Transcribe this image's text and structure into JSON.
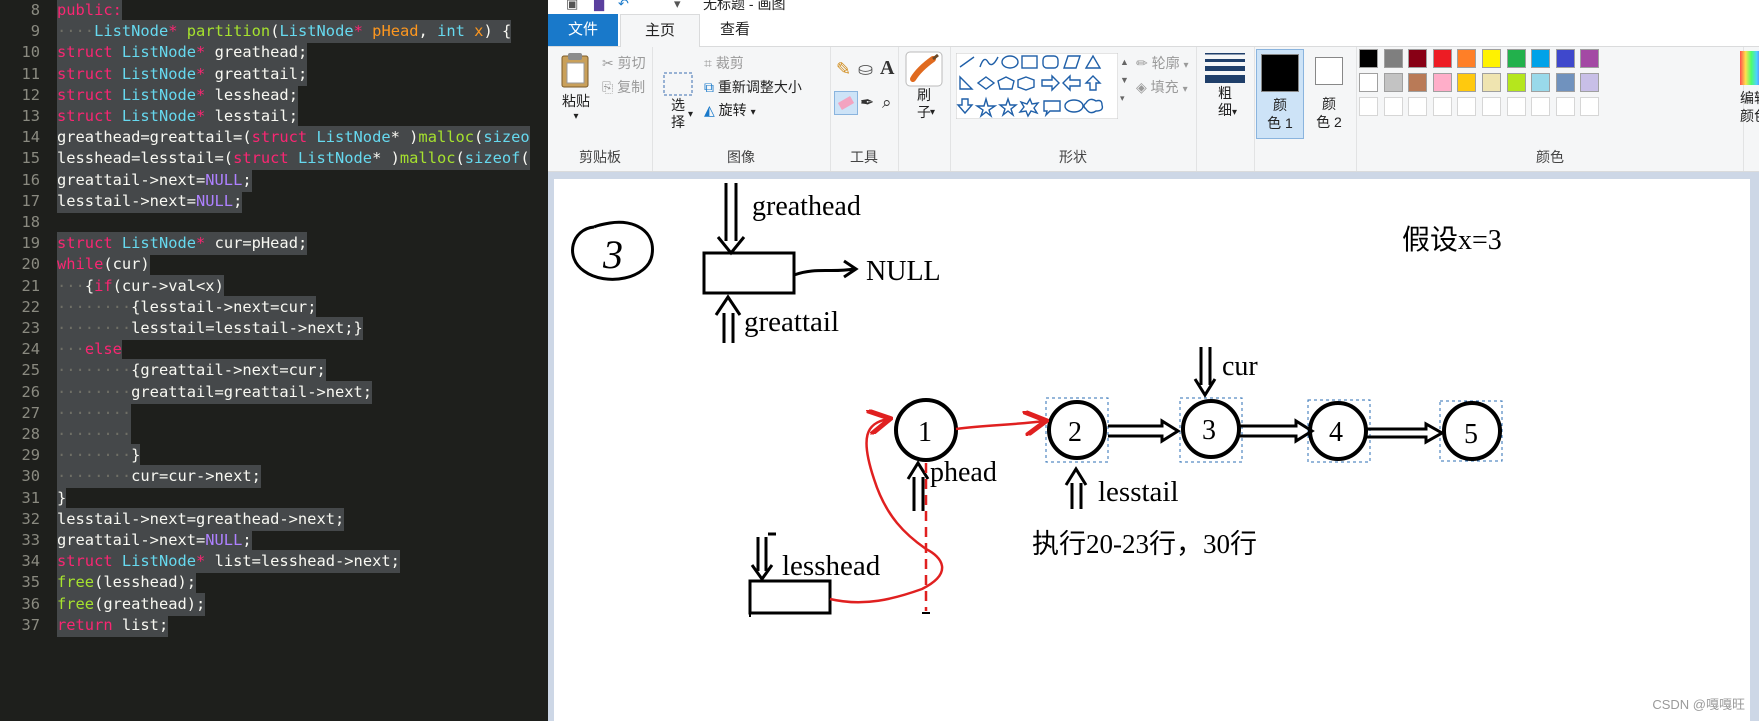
{
  "editor": {
    "lines": [
      {
        "n": "8",
        "sel": true,
        "t": [
          [
            "public:",
            "t-kw"
          ]
        ]
      },
      {
        "n": "9",
        "sel": true,
        "t": [
          [
            "····",
            "t-ws"
          ],
          [
            "ListNode",
            "t-type"
          ],
          [
            "*",
            "t-pun"
          ],
          [
            " ",
            ""
          ],
          [
            "partition",
            "t-fn"
          ],
          [
            "(",
            ""
          ],
          [
            "ListNode",
            "t-type"
          ],
          [
            "*",
            "t-pun"
          ],
          [
            " ",
            ""
          ],
          [
            "pHead",
            "t-par"
          ],
          [
            ", ",
            ""
          ],
          [
            "int",
            "t-type"
          ],
          [
            " ",
            ""
          ],
          [
            "x",
            "t-par"
          ],
          [
            ") {",
            ""
          ]
        ]
      },
      {
        "n": "10",
        "sel": true,
        "t": [
          [
            "struct",
            "t-kw"
          ],
          [
            " ListNode",
            "t-type"
          ],
          [
            "*",
            "t-pun"
          ],
          [
            " greathead;",
            ""
          ]
        ]
      },
      {
        "n": "11",
        "sel": true,
        "t": [
          [
            "struct",
            "t-kw"
          ],
          [
            " ListNode",
            "t-type"
          ],
          [
            "*",
            "t-pun"
          ],
          [
            " greattail;",
            ""
          ]
        ]
      },
      {
        "n": "12",
        "sel": true,
        "t": [
          [
            "struct",
            "t-kw"
          ],
          [
            " ListNode",
            "t-type"
          ],
          [
            "*",
            "t-pun"
          ],
          [
            " lesshead;",
            ""
          ]
        ]
      },
      {
        "n": "13",
        "sel": true,
        "t": [
          [
            "struct",
            "t-kw"
          ],
          [
            " ListNode",
            "t-type"
          ],
          [
            "*",
            "t-pun"
          ],
          [
            " lesstail;",
            ""
          ]
        ]
      },
      {
        "n": "14",
        "sel": true,
        "t": [
          [
            "greathead=greattail=(",
            ""
          ],
          [
            "struct",
            "t-kw"
          ],
          [
            " ListNode",
            "t-type"
          ],
          [
            "* )",
            ""
          ],
          [
            "malloc",
            "t-fn"
          ],
          [
            "(",
            ""
          ],
          [
            "sizeo",
            "t-type"
          ]
        ]
      },
      {
        "n": "15",
        "sel": true,
        "t": [
          [
            "lesshead=lesstail=(",
            ""
          ],
          [
            "struct",
            "t-kw"
          ],
          [
            " ListNode",
            "t-type"
          ],
          [
            "* )",
            ""
          ],
          [
            "malloc",
            "t-fn"
          ],
          [
            "(",
            ""
          ],
          [
            "sizeof",
            "t-type"
          ],
          [
            "(",
            ""
          ]
        ]
      },
      {
        "n": "16",
        "sel": true,
        "t": [
          [
            "greattail->next=",
            ""
          ],
          [
            "NULL",
            "t-num"
          ],
          [
            ";",
            ""
          ]
        ]
      },
      {
        "n": "17",
        "sel": true,
        "t": [
          [
            "lesstail->next=",
            ""
          ],
          [
            "NULL",
            "t-num"
          ],
          [
            ";",
            ""
          ]
        ]
      },
      {
        "n": "18",
        "sel": false,
        "t": [
          [
            "",
            ""
          ]
        ]
      },
      {
        "n": "19",
        "sel": true,
        "t": [
          [
            "struct",
            "t-kw"
          ],
          [
            " ListNode",
            "t-type"
          ],
          [
            "*",
            "t-pun"
          ],
          [
            " cur=pHead;",
            ""
          ]
        ]
      },
      {
        "n": "20",
        "sel": true,
        "t": [
          [
            "while",
            "t-kw"
          ],
          [
            "(cur)",
            ""
          ]
        ]
      },
      {
        "n": "21",
        "sel": true,
        "t": [
          [
            "···",
            "t-ws"
          ],
          [
            "{",
            ""
          ],
          [
            "if",
            "t-kw"
          ],
          [
            "(cur->val<x)",
            ""
          ]
        ]
      },
      {
        "n": "22",
        "sel": true,
        "t": [
          [
            "········",
            "t-ws"
          ],
          [
            "{lesstail->next=cur;",
            ""
          ]
        ]
      },
      {
        "n": "23",
        "sel": true,
        "t": [
          [
            "········",
            "t-ws"
          ],
          [
            "lesstail=lesstail->next;}",
            ""
          ]
        ]
      },
      {
        "n": "24",
        "sel": true,
        "t": [
          [
            "···",
            "t-ws"
          ],
          [
            "else",
            "t-kw"
          ]
        ]
      },
      {
        "n": "25",
        "sel": true,
        "t": [
          [
            "········",
            "t-ws"
          ],
          [
            "{greattail->next=cur;",
            ""
          ]
        ]
      },
      {
        "n": "26",
        "sel": true,
        "t": [
          [
            "········",
            "t-ws"
          ],
          [
            "greattail=greattail->next;",
            ""
          ]
        ]
      },
      {
        "n": "27",
        "sel": true,
        "t": [
          [
            "········",
            "t-ws"
          ]
        ]
      },
      {
        "n": "28",
        "sel": true,
        "t": [
          [
            "········",
            "t-ws"
          ]
        ]
      },
      {
        "n": "29",
        "sel": true,
        "t": [
          [
            "········",
            "t-ws"
          ],
          [
            "}",
            ""
          ]
        ]
      },
      {
        "n": "30",
        "sel": true,
        "t": [
          [
            "········",
            "t-ws"
          ],
          [
            "cur=cur->next;",
            ""
          ]
        ]
      },
      {
        "n": "31",
        "sel": true,
        "t": [
          [
            "}",
            ""
          ]
        ]
      },
      {
        "n": "32",
        "sel": true,
        "t": [
          [
            "lesstail->next=greathead->next;",
            ""
          ]
        ]
      },
      {
        "n": "33",
        "sel": true,
        "t": [
          [
            "greattail->next=",
            ""
          ],
          [
            "NULL",
            "t-num"
          ],
          [
            ";",
            ""
          ]
        ]
      },
      {
        "n": "34",
        "sel": true,
        "t": [
          [
            "struct",
            "t-kw"
          ],
          [
            " ListNode",
            "t-type"
          ],
          [
            "*",
            "t-pun"
          ],
          [
            " list=lesshead->next;",
            ""
          ]
        ]
      },
      {
        "n": "35",
        "sel": true,
        "t": [
          [
            "free",
            "t-fn"
          ],
          [
            "(lesshead);",
            ""
          ]
        ]
      },
      {
        "n": "36",
        "sel": true,
        "t": [
          [
            "free",
            "t-fn"
          ],
          [
            "(greathead);",
            ""
          ]
        ]
      },
      {
        "n": "37",
        "sel": true,
        "t": [
          [
            "return",
            "t-kw"
          ],
          [
            " list;",
            ""
          ]
        ]
      }
    ]
  },
  "paint": {
    "title": "无标题 - 画图",
    "tabs": {
      "file": "文件",
      "home": "主页",
      "view": "查看"
    },
    "clipboard": {
      "paste": "粘贴",
      "cut": "剪切",
      "copy": "复制",
      "label": "剪贴板"
    },
    "image": {
      "select": "选\n择",
      "crop": "裁剪",
      "resize": "重新调整大小",
      "rotate": "旋转",
      "label": "图像"
    },
    "tools": {
      "label": "工具"
    },
    "brushes": {
      "label": "刷\n子"
    },
    "shapes": {
      "outline": "轮廓",
      "fill": "填充",
      "label": "形状"
    },
    "size": {
      "label": "粗\n细"
    },
    "color1": {
      "label": "颜\n色 1",
      "value": "#000000"
    },
    "color2": {
      "label": "颜\n色 2",
      "value": "#ffffff"
    },
    "colors": {
      "label": "颜色",
      "row1": [
        "#000000",
        "#7f7f7f",
        "#880015",
        "#ed1c24",
        "#ff7f27",
        "#fff200",
        "#22b14c",
        "#00a2e8",
        "#3f48cc",
        "#a349a4"
      ],
      "row2": [
        "#ffffff",
        "#c3c3c3",
        "#b97a57",
        "#ffaec9",
        "#ffc90e",
        "#efe4b0",
        "#b5e61d",
        "#99d9ea",
        "#7092be",
        "#c8bfe7"
      ]
    },
    "edit_colors": "编辑\n颜色"
  },
  "drawing": {
    "step_number": "3",
    "greathead": "greathead",
    "null_text": "NULL",
    "greattail": "greattail",
    "assume": "假设x=3",
    "cur": "cur",
    "nodes": [
      "1",
      "2",
      "3",
      "4",
      "5"
    ],
    "phead": "phead",
    "lesstail": "lesstail",
    "exec_note": "执行20-23行，30行",
    "lesshead": "lesshead"
  },
  "watermark": "CSDN @嘎嘎旺"
}
